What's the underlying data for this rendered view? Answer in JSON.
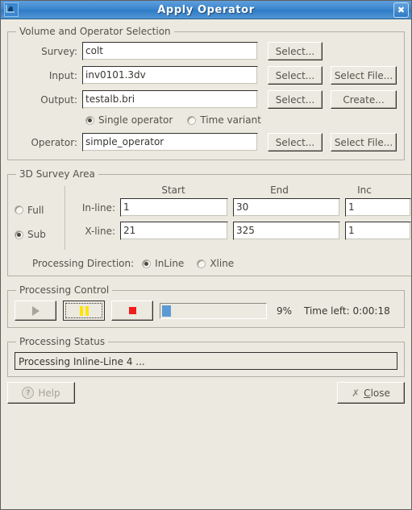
{
  "window": {
    "title": "Apply Operator",
    "icon": "chart-icon",
    "close_label": "✖"
  },
  "volume_group": {
    "legend": "Volume and Operator Selection",
    "survey": {
      "label": "Survey:",
      "value": "colt",
      "select_label": "Select..."
    },
    "input": {
      "label": "Input:",
      "value": "inv0101.3dv",
      "select_label": "Select...",
      "select_file_label": "Select File..."
    },
    "output": {
      "label": "Output:",
      "value": "testalb.bri",
      "select_label": "Select...",
      "create_label": "Create..."
    },
    "operator_mode": {
      "single_label": "Single operator",
      "time_variant_label": "Time variant",
      "selected": "single"
    },
    "operator": {
      "label": "Operator:",
      "value": "simple_operator",
      "select_label": "Select...",
      "select_file_label": "Select File..."
    }
  },
  "survey_area": {
    "legend": "3D Survey Area",
    "extent": {
      "full_label": "Full",
      "sub_label": "Sub",
      "selected": "sub"
    },
    "columns": {
      "start": "Start",
      "end": "End",
      "inc": "Inc"
    },
    "rows": [
      {
        "label": "In-line:",
        "start": "1",
        "end": "30",
        "inc": "1"
      },
      {
        "label": "X-line:",
        "start": "21",
        "end": "325",
        "inc": "1"
      }
    ],
    "processing_direction": {
      "label": "Processing Direction:",
      "inline_label": "InLine",
      "xline_label": "Xline",
      "selected": "inline"
    }
  },
  "processing_control": {
    "legend": "Processing Control",
    "play_label": "play-button",
    "pause_label": "pause-button",
    "stop_label": "stop-button",
    "progress_percent": 9,
    "percent_text": "9%",
    "time_left_text": "Time left:  0:00:18",
    "progress_color": "#5a9bd4",
    "pause_color": "#ffe400",
    "stop_color": "#f01d1d"
  },
  "processing_status": {
    "legend": "Processing Status",
    "message": "Processing Inline-Line 4 ..."
  },
  "footer": {
    "help_label": "Help",
    "close_label": "Close",
    "close_mnemonic": "C"
  }
}
